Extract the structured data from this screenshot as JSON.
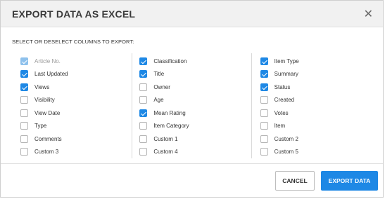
{
  "dialog": {
    "title": "EXPORT DATA AS EXCEL",
    "close_icon": "close-icon",
    "instructions": "SELECT OR DESELECT COLUMNS TO EXPORT:"
  },
  "columns": [
    [
      {
        "label": "Article No.",
        "checked": true,
        "disabled": true
      },
      {
        "label": "Last Updated",
        "checked": true,
        "disabled": false
      },
      {
        "label": "Views",
        "checked": true,
        "disabled": false
      },
      {
        "label": "Visibility",
        "checked": false,
        "disabled": false
      },
      {
        "label": "View Date",
        "checked": false,
        "disabled": false
      },
      {
        "label": "Type",
        "checked": false,
        "disabled": false
      },
      {
        "label": "Comments",
        "checked": false,
        "disabled": false
      },
      {
        "label": "Custom 3",
        "checked": false,
        "disabled": false
      }
    ],
    [
      {
        "label": "Classification",
        "checked": true,
        "disabled": false
      },
      {
        "label": "Title",
        "checked": true,
        "disabled": false
      },
      {
        "label": "Owner",
        "checked": false,
        "disabled": false
      },
      {
        "label": "Age",
        "checked": false,
        "disabled": false
      },
      {
        "label": "Mean Rating",
        "checked": true,
        "disabled": false
      },
      {
        "label": "Item Category",
        "checked": false,
        "disabled": false
      },
      {
        "label": "Custom 1",
        "checked": false,
        "disabled": false
      },
      {
        "label": "Custom 4",
        "checked": false,
        "disabled": false
      }
    ],
    [
      {
        "label": "Item Type",
        "checked": true,
        "disabled": false
      },
      {
        "label": "Summary",
        "checked": true,
        "disabled": false
      },
      {
        "label": "Status",
        "checked": true,
        "disabled": false
      },
      {
        "label": "Created",
        "checked": false,
        "disabled": false
      },
      {
        "label": "Votes",
        "checked": false,
        "disabled": false
      },
      {
        "label": "Item",
        "checked": false,
        "disabled": false
      },
      {
        "label": "Custom 2",
        "checked": false,
        "disabled": false
      },
      {
        "label": "Custom 5",
        "checked": false,
        "disabled": false
      }
    ]
  ],
  "footer": {
    "cancel_label": "CANCEL",
    "export_label": "EXPORT DATA"
  },
  "colors": {
    "accent": "#1e88e5",
    "accent_disabled": "#8ec1ec",
    "header_bg": "#f1f1f1"
  }
}
